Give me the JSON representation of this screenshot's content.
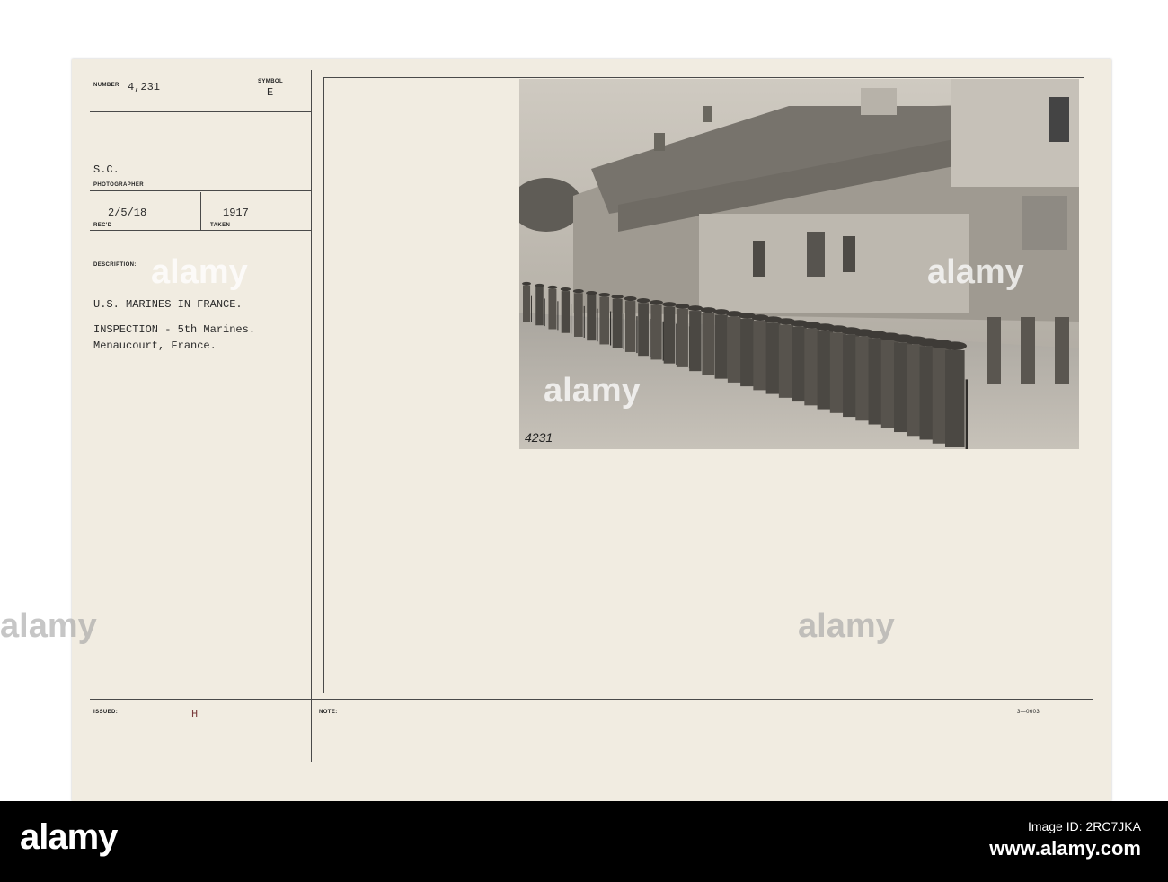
{
  "card": {
    "number_label": "NUMBER",
    "number_value": "4,231",
    "symbol_label": "SYMBOL",
    "symbol_value": "E",
    "photographer_value": "S.C.",
    "photographer_label": "PHOTOGRAPHER",
    "recd_value": "2/5/18",
    "recd_label": "REC'D",
    "taken_value": "1917",
    "taken_label": "TAKEN",
    "description_label": "DESCRIPTION:",
    "description_lines": [
      "U.S. MARINES IN FRANCE.",
      "INSPECTION - 5th Marines.",
      "Menaucourt, France."
    ],
    "issued_label": "ISSUED:",
    "issued_value": "H",
    "note_label": "NOTE:",
    "form_number": "3—0603",
    "photo_inscription": "4231"
  },
  "watermark": {
    "brand": "alamy",
    "image_id_label": "Image ID: 2RC7JKA",
    "url": "www.alamy.com"
  },
  "colors": {
    "card_bg": "#f1ece1",
    "rule_line": "#4a4a4a",
    "bar_bg": "#000000"
  }
}
